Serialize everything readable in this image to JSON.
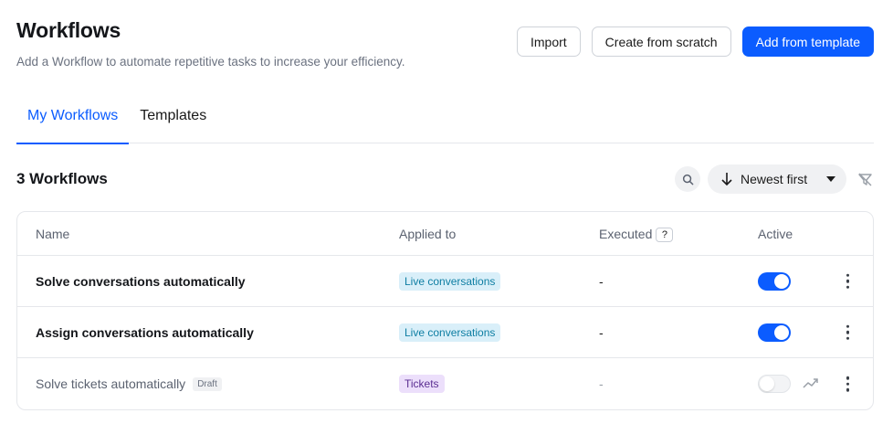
{
  "header": {
    "title": "Workflows",
    "subtitle": "Add a Workflow to automate repetitive tasks to increase your efficiency.",
    "import_label": "Import",
    "create_label": "Create from scratch",
    "template_label": "Add from template"
  },
  "tabs": [
    {
      "label": "My Workflows",
      "active": true
    },
    {
      "label": "Templates",
      "active": false
    }
  ],
  "toolbar": {
    "count": "3 Workflows",
    "sort_label": "Newest first",
    "search_icon": "search-icon",
    "filter_icon": "filter-off-icon"
  },
  "table": {
    "columns": {
      "name": "Name",
      "applied": "Applied to",
      "executed": "Executed",
      "executed_help": "?",
      "active": "Active"
    },
    "rows": [
      {
        "name": "Solve conversations automatically",
        "applied": "Live conversations",
        "executed": "-",
        "active": true,
        "draft": ""
      },
      {
        "name": "Assign conversations automatically",
        "applied": "Live conversations",
        "executed": "-",
        "active": true,
        "draft": ""
      },
      {
        "name": "Solve tickets automatically",
        "applied": "Tickets",
        "executed": "-",
        "active": false,
        "draft": "Draft"
      }
    ]
  },
  "colors": {
    "accent": "#0b5cff",
    "live_badge_bg": "#d9eff9",
    "tickets_badge_bg": "#ecdffb"
  }
}
